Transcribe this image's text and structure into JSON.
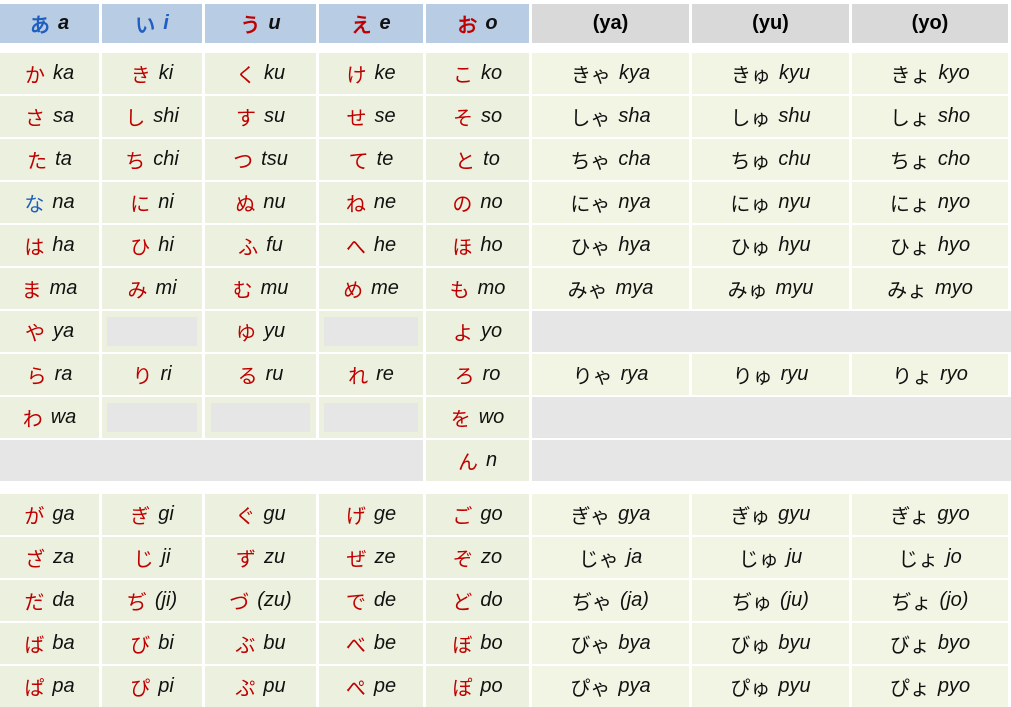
{
  "colors": {
    "red": "#c00000",
    "blue": "#1f5fbf",
    "header_blue": "#b8cce4",
    "header_gray": "#d9d9d9",
    "green_cell": "#ebf1de",
    "cream_cell": "#f2f5e4",
    "empty_cell": "#e6e6e6"
  },
  "header": {
    "vowels": [
      {
        "kana": "あ",
        "romaji": "a"
      },
      {
        "kana": "い",
        "romaji": "i"
      },
      {
        "kana": "う",
        "romaji": "u"
      },
      {
        "kana": "え",
        "romaji": "e"
      },
      {
        "kana": "お",
        "romaji": "o"
      }
    ],
    "yoon": [
      "(ya)",
      "(yu)",
      "(yo)"
    ]
  },
  "rows": [
    [
      {
        "kana": "か",
        "romaji": "ka"
      },
      {
        "kana": "き",
        "romaji": "ki"
      },
      {
        "kana": "く",
        "romaji": "ku"
      },
      {
        "kana": "け",
        "romaji": "ke"
      },
      {
        "kana": "こ",
        "romaji": "ko"
      },
      {
        "kana": "きゃ",
        "romaji": "kya"
      },
      {
        "kana": "きゅ",
        "romaji": "kyu"
      },
      {
        "kana": "きょ",
        "romaji": "kyo"
      }
    ],
    [
      {
        "kana": "さ",
        "romaji": "sa"
      },
      {
        "kana": "し",
        "romaji": "shi"
      },
      {
        "kana": "す",
        "romaji": "su"
      },
      {
        "kana": "せ",
        "romaji": "se"
      },
      {
        "kana": "そ",
        "romaji": "so"
      },
      {
        "kana": "しゃ",
        "romaji": "sha"
      },
      {
        "kana": "しゅ",
        "romaji": "shu"
      },
      {
        "kana": "しょ",
        "romaji": "sho"
      }
    ],
    [
      {
        "kana": "た",
        "romaji": "ta"
      },
      {
        "kana": "ち",
        "romaji": "chi"
      },
      {
        "kana": "つ",
        "romaji": "tsu"
      },
      {
        "kana": "て",
        "romaji": "te"
      },
      {
        "kana": "と",
        "romaji": "to"
      },
      {
        "kana": "ちゃ",
        "romaji": "cha"
      },
      {
        "kana": "ちゅ",
        "romaji": "chu"
      },
      {
        "kana": "ちょ",
        "romaji": "cho"
      }
    ],
    [
      {
        "kana": "な",
        "romaji": "na"
      },
      {
        "kana": "に",
        "romaji": "ni"
      },
      {
        "kana": "ぬ",
        "romaji": "nu"
      },
      {
        "kana": "ね",
        "romaji": "ne"
      },
      {
        "kana": "の",
        "romaji": "no"
      },
      {
        "kana": "にゃ",
        "romaji": "nya"
      },
      {
        "kana": "にゅ",
        "romaji": "nyu"
      },
      {
        "kana": "にょ",
        "romaji": "nyo"
      }
    ],
    [
      {
        "kana": "は",
        "romaji": "ha"
      },
      {
        "kana": "ひ",
        "romaji": "hi"
      },
      {
        "kana": "ふ",
        "romaji": "fu"
      },
      {
        "kana": "へ",
        "romaji": "he"
      },
      {
        "kana": "ほ",
        "romaji": "ho"
      },
      {
        "kana": "ひゃ",
        "romaji": "hya"
      },
      {
        "kana": "ひゅ",
        "romaji": "hyu"
      },
      {
        "kana": "ひょ",
        "romaji": "hyo"
      }
    ],
    [
      {
        "kana": "ま",
        "romaji": "ma"
      },
      {
        "kana": "み",
        "romaji": "mi"
      },
      {
        "kana": "む",
        "romaji": "mu"
      },
      {
        "kana": "め",
        "romaji": "me"
      },
      {
        "kana": "も",
        "romaji": "mo"
      },
      {
        "kana": "みゃ",
        "romaji": "mya"
      },
      {
        "kana": "みゅ",
        "romaji": "myu"
      },
      {
        "kana": "みょ",
        "romaji": "myo"
      }
    ],
    [
      {
        "kana": "や",
        "romaji": "ya"
      },
      null,
      {
        "kana": "ゆ",
        "romaji": "yu"
      },
      null,
      {
        "kana": "よ",
        "romaji": "yo"
      },
      null,
      null,
      null
    ],
    [
      {
        "kana": "ら",
        "romaji": "ra"
      },
      {
        "kana": "り",
        "romaji": "ri"
      },
      {
        "kana": "る",
        "romaji": "ru"
      },
      {
        "kana": "れ",
        "romaji": "re"
      },
      {
        "kana": "ろ",
        "romaji": "ro"
      },
      {
        "kana": "りゃ",
        "romaji": "rya"
      },
      {
        "kana": "りゅ",
        "romaji": "ryu"
      },
      {
        "kana": "りょ",
        "romaji": "ryo"
      }
    ],
    [
      {
        "kana": "わ",
        "romaji": "wa"
      },
      null,
      null,
      null,
      {
        "kana": "を",
        "romaji": "wo"
      },
      null,
      null,
      null
    ],
    [
      null,
      null,
      null,
      null,
      {
        "kana": "ん",
        "romaji": "n"
      },
      null,
      null,
      null
    ],
    [
      {
        "kana": "が",
        "romaji": "ga"
      },
      {
        "kana": "ぎ",
        "romaji": "gi"
      },
      {
        "kana": "ぐ",
        "romaji": "gu"
      },
      {
        "kana": "げ",
        "romaji": "ge"
      },
      {
        "kana": "ご",
        "romaji": "go"
      },
      {
        "kana": "ぎゃ",
        "romaji": "gya"
      },
      {
        "kana": "ぎゅ",
        "romaji": "gyu"
      },
      {
        "kana": "ぎょ",
        "romaji": "gyo"
      }
    ],
    [
      {
        "kana": "ざ",
        "romaji": "za"
      },
      {
        "kana": "じ",
        "romaji": "ji"
      },
      {
        "kana": "ず",
        "romaji": "zu"
      },
      {
        "kana": "ぜ",
        "romaji": "ze"
      },
      {
        "kana": "ぞ",
        "romaji": "zo"
      },
      {
        "kana": "じゃ",
        "romaji": "ja"
      },
      {
        "kana": "じゅ",
        "romaji": "ju"
      },
      {
        "kana": "じょ",
        "romaji": "jo"
      }
    ],
    [
      {
        "kana": "だ",
        "romaji": "da"
      },
      {
        "kana": "ぢ",
        "romaji": "(ji)"
      },
      {
        "kana": "づ",
        "romaji": "(zu)"
      },
      {
        "kana": "で",
        "romaji": "de"
      },
      {
        "kana": "ど",
        "romaji": "do"
      },
      {
        "kana": "ぢゃ",
        "romaji": "(ja)"
      },
      {
        "kana": "ぢゅ",
        "romaji": "(ju)"
      },
      {
        "kana": "ぢょ",
        "romaji": "(jo)"
      }
    ],
    [
      {
        "kana": "ば",
        "romaji": "ba"
      },
      {
        "kana": "び",
        "romaji": "bi"
      },
      {
        "kana": "ぶ",
        "romaji": "bu"
      },
      {
        "kana": "べ",
        "romaji": "be"
      },
      {
        "kana": "ぼ",
        "romaji": "bo"
      },
      {
        "kana": "びゃ",
        "romaji": "bya"
      },
      {
        "kana": "びゅ",
        "romaji": "byu"
      },
      {
        "kana": "びょ",
        "romaji": "byo"
      }
    ],
    [
      {
        "kana": "ぱ",
        "romaji": "pa"
      },
      {
        "kana": "ぴ",
        "romaji": "pi"
      },
      {
        "kana": "ぷ",
        "romaji": "pu"
      },
      {
        "kana": "ぺ",
        "romaji": "pe"
      },
      {
        "kana": "ぽ",
        "romaji": "po"
      },
      {
        "kana": "ぴゃ",
        "romaji": "pya"
      },
      {
        "kana": "ぴゅ",
        "romaji": "pyu"
      },
      {
        "kana": "ぴょ",
        "romaji": "pyo"
      }
    ]
  ]
}
